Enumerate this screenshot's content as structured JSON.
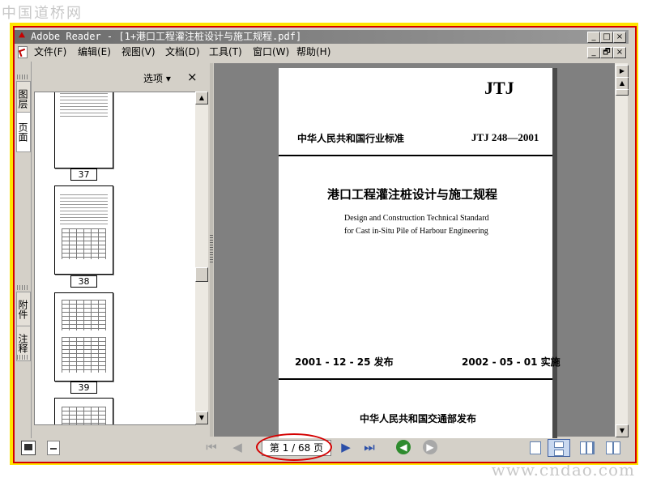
{
  "watermark_top": "中国道桥网",
  "watermark_bottom": "www.cndao.com",
  "window": {
    "title": "Adobe Reader - [1+港口工程灌注桩设计与施工规程.pdf]",
    "controls": {
      "minimize": "_",
      "maximize": "□",
      "close": "×",
      "restore": "🗗"
    }
  },
  "menu": {
    "items": [
      "文件(F)",
      "编辑(E)",
      "视图(V)",
      "文档(D)",
      "工具(T)",
      "窗口(W)",
      "帮助(H)"
    ]
  },
  "left_tabs": [
    "图层",
    "页面",
    "附件",
    "注释"
  ],
  "panel": {
    "options_label": "选项 ▾",
    "close_label": "×",
    "thumbnails": [
      "37",
      "38",
      "39"
    ]
  },
  "document": {
    "header_code": "JTJ",
    "issuer_line": "中华人民共和国行业标准",
    "standard_number": "JTJ 248—2001",
    "title_cn": "港口工程灌注桩设计与施工规程",
    "title_en_1": "Design and Construction Technical Standard",
    "title_en_2": "for Cast in-Situ Pile of Harbour Engineering",
    "issue_date": "2001 - 12 - 25 发布",
    "effective_date": "2002 - 05 - 01 实施",
    "publisher": "中华人民共和国交通部发布"
  },
  "status": {
    "page_indicator": "第 1 / 68 页",
    "current_page": 1,
    "total_pages": 68
  },
  "colors": {
    "frame_yellow": "#ffe400",
    "frame_red": "#d40000",
    "nav_green": "#2e8b2e"
  }
}
